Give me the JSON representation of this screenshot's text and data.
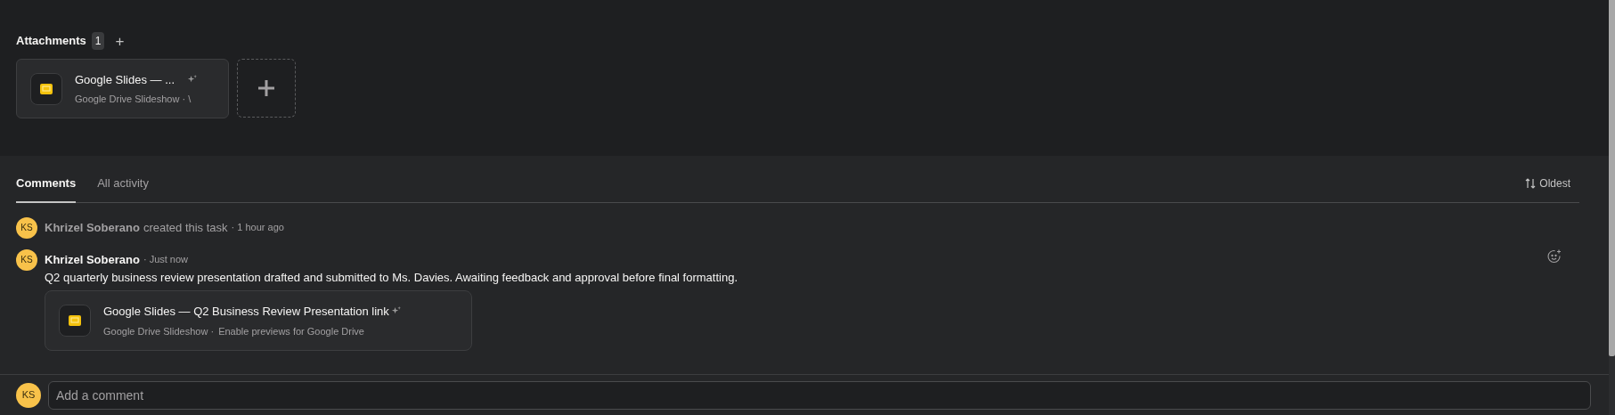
{
  "attachments": {
    "title": "Attachments",
    "count": "1",
    "add_icon": "+",
    "items": [
      {
        "title": "Google Slides — ...",
        "subtitle": "Google Drive Slideshow · \\"
      }
    ]
  },
  "tabs": [
    {
      "label": "Comments",
      "selected": true
    },
    {
      "label": "All activity",
      "selected": false
    }
  ],
  "sort": {
    "label": "Oldest"
  },
  "activity": [
    {
      "kind": "event",
      "initials": "KS",
      "author": "Khrizel Soberano",
      "text": "created this task",
      "time": "· 1 hour ago"
    },
    {
      "kind": "comment",
      "initials": "KS",
      "author": "Khrizel Soberano",
      "time": "· Just now",
      "text": "Q2 quarterly business review presentation drafted and submitted to Ms. Davies. Awaiting feedback and approval before final formatting.",
      "attachment": {
        "title": "Google Slides — Q2 Business Review Presentation link",
        "subtitle": "Google Drive Slideshow ·",
        "action": "Enable previews for Google Drive"
      }
    }
  ],
  "composer": {
    "initials": "KS",
    "placeholder": "Add a comment"
  }
}
